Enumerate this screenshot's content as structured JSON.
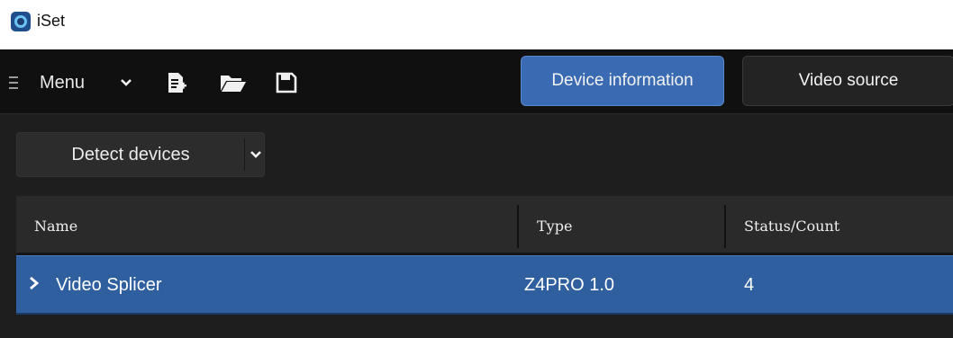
{
  "window": {
    "title": "iSet"
  },
  "toolbar": {
    "menu_label": "Menu",
    "icons": [
      "menu-lines-icon",
      "chevron-down-icon",
      "new-file-icon",
      "open-folder-icon",
      "save-icon"
    ],
    "tabs": [
      {
        "label": "Device information",
        "active": true
      },
      {
        "label": "Video source",
        "active": false
      }
    ]
  },
  "detect": {
    "label": "Detect devices"
  },
  "table": {
    "columns": [
      "Name",
      "Type",
      "Status/Count"
    ],
    "rows": [
      {
        "name": "Video Splicer",
        "type": "Z4PRO 1.0",
        "status": "4",
        "selected": true,
        "expandable": true
      }
    ]
  },
  "colors": {
    "accent": "#3a6bb2",
    "selected_row": "#2f5f9e",
    "toolbar_bg": "#101010",
    "panel_bg": "#1e1e1e"
  }
}
